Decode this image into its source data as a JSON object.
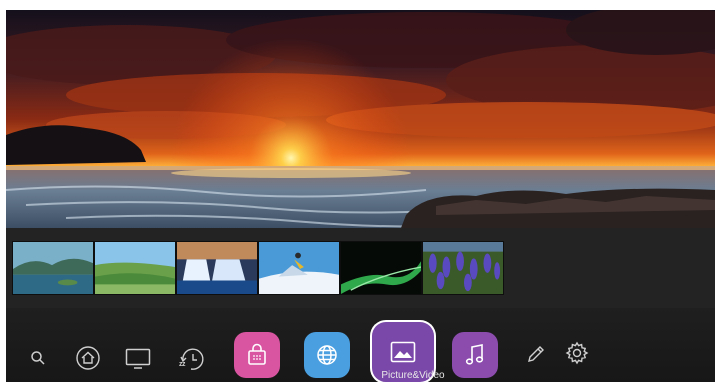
{
  "dock": {
    "focused_app_label": "Picture&Video",
    "apps": [
      {
        "icon": "shopping-bag-icon",
        "color": "#d955a1"
      },
      {
        "icon": "globe-icon",
        "color": "#4a9fe0"
      },
      {
        "icon": "picture-icon",
        "color": "#7a48a8"
      },
      {
        "icon": "music-note-icon",
        "color": "#8b4cae"
      }
    ],
    "system_icons": [
      "search-icon",
      "home-icon",
      "tv-icon",
      "sleep-timer-icon",
      "edit-icon",
      "gear-icon"
    ],
    "sleep_timer_badge": "zz"
  },
  "thumbnails": [
    {
      "subject": "lake-mountains"
    },
    {
      "subject": "green-hills"
    },
    {
      "subject": "waterfall"
    },
    {
      "subject": "snowboarder"
    },
    {
      "subject": "green-wave"
    },
    {
      "subject": "purple-flowers"
    }
  ],
  "colors": {
    "background": "#1b1b1b",
    "strip": "#232323",
    "label": "#e8e8e8"
  }
}
